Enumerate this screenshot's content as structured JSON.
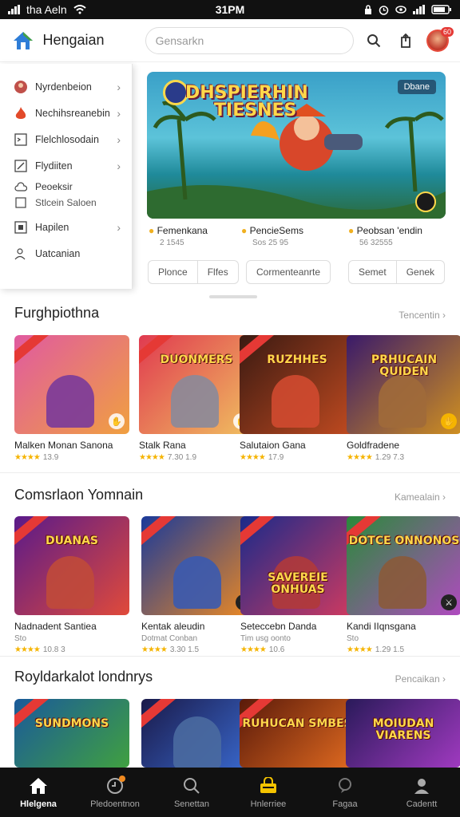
{
  "status": {
    "carrier": "tha Aeln",
    "time": "31PM"
  },
  "header": {
    "brand": "Hengaian",
    "search_placeholder": "Gensarkn",
    "avatar_badge": "60"
  },
  "sidebar": {
    "items": [
      {
        "label": "Nyrdenbeion",
        "icon": "avatar-icon"
      },
      {
        "label": "Nechihsreanebin",
        "icon": "flame-icon"
      },
      {
        "label": "Flelchlosodain",
        "icon": "terminal-icon"
      },
      {
        "label": "Flydiiten",
        "icon": "edit-icon"
      },
      {
        "label": "Peoeksir",
        "sub": "Stlcein Saloen",
        "icon": "cloud-icon"
      },
      {
        "label": "Hapilen",
        "icon": "square-icon"
      },
      {
        "label": "Uatcanian",
        "icon": "user-gear-icon"
      }
    ]
  },
  "hero": {
    "title_line1": "DHSPIERHIN",
    "title_line2": "TIESNES",
    "tag": "Dbane",
    "meta": [
      {
        "title": "Femenkana",
        "sub": "2 1545"
      },
      {
        "title": "PencieSems",
        "sub": "Sos 25 95"
      },
      {
        "title": "Peobsan 'endin",
        "sub": "56 32555"
      }
    ],
    "chips": [
      [
        "Plonce",
        "Flfes"
      ],
      [
        "Cormenteanrte"
      ],
      [
        "Semet",
        "Genek"
      ]
    ]
  },
  "sections": [
    {
      "title": "Furghpiothna",
      "more": "Tencentin",
      "cards": [
        {
          "name": "Malken Monan Sanona",
          "rating": "13.9",
          "art": "",
          "colors": [
            "#e05aa0",
            "#f0a040"
          ]
        },
        {
          "name": "Stalk Rana",
          "rating": "7.30 1.9",
          "art": "DUONMERS",
          "colors": [
            "#e03a50",
            "#f0c060"
          ]
        },
        {
          "name": "Salutaion Gana",
          "rating": "17.9",
          "art": "RUZHHES",
          "colors": [
            "#3a1a12",
            "#c04a20"
          ]
        },
        {
          "name": "Goldfradene",
          "rating": "1.29 7.3",
          "art": "PRHUCAIN QUIDEN",
          "colors": [
            "#3a1a6a",
            "#d09020"
          ]
        }
      ]
    },
    {
      "title": "Comsrlaon Yomnain",
      "more": "Kamealain",
      "cards": [
        {
          "name": "Nadnadent Santiea",
          "rating": "10.8 3",
          "sub": "Sto",
          "art": "DUANAS",
          "colors": [
            "#5a1a8a",
            "#e04a3a"
          ]
        },
        {
          "name": "Kentak aleudin",
          "rating": "3.30 1.5",
          "sub": "Dotmat Conban",
          "art": "",
          "colors": [
            "#1a3a9a",
            "#f08a20"
          ]
        },
        {
          "name": "Seteccebn Danda",
          "rating": "10.6",
          "sub": "Tim usg oonto",
          "art": "SAVEREIE ONHUAS",
          "colors": [
            "#1a2a8a",
            "#d03a60"
          ]
        },
        {
          "name": "Kandi IIqnsgana",
          "rating": "1.29 1.5",
          "sub": "Sto",
          "art": "DOTCE ONNONOS",
          "colors": [
            "#2a8a3a",
            "#b04ac0"
          ]
        }
      ]
    },
    {
      "title": "Royldarkalot londnrys",
      "more": "Pencaikan",
      "cards": [
        {
          "name": "",
          "rating": "",
          "art": "SUNDMONS",
          "colors": [
            "#1a5a9a",
            "#40a040"
          ]
        },
        {
          "name": "",
          "rating": "",
          "art": "",
          "colors": [
            "#1a1a4a",
            "#3a6ad0"
          ]
        },
        {
          "name": "",
          "rating": "",
          "art": "RUHUCAN SMBES",
          "colors": [
            "#5a1a0a",
            "#e06a20"
          ]
        },
        {
          "name": "",
          "rating": "",
          "art": "MOIUDAN VIARENS",
          "colors": [
            "#2a1a5a",
            "#a03ac0"
          ]
        }
      ]
    }
  ],
  "nav": [
    {
      "label": "Hlelgena",
      "icon": "home-icon",
      "active": true
    },
    {
      "label": "Pledoentnon",
      "icon": "clock-icon"
    },
    {
      "label": "Senettan",
      "icon": "search-icon"
    },
    {
      "label": "Hnlerriee",
      "icon": "bag-icon"
    },
    {
      "label": "Fagaa",
      "icon": "chat-icon"
    },
    {
      "label": "Cadentt",
      "icon": "profile-icon"
    }
  ],
  "colors": {
    "accent": "#e53935",
    "star": "#f5b400",
    "nav_bg": "#111111"
  }
}
